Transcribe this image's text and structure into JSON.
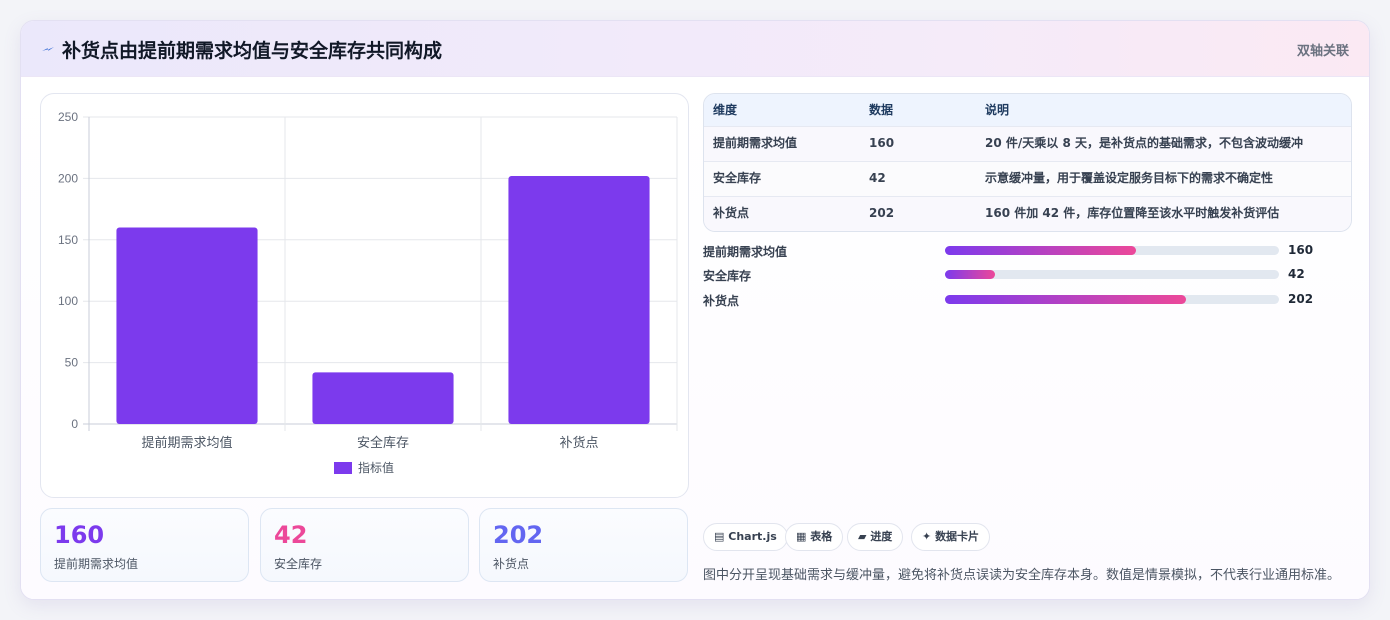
{
  "header": {
    "title": "补货点由提前期需求均值与安全库存共同构成",
    "tag": "双轴关联",
    "icon": "bolt-icon"
  },
  "chart_data": {
    "type": "bar",
    "categories": [
      "提前期需求均值",
      "安全库存",
      "补货点"
    ],
    "series": [
      {
        "name": "指标值",
        "values": [
          160,
          42,
          202
        ],
        "color": "#7c3aed"
      }
    ],
    "ylim": [
      0,
      250
    ],
    "yticks": [
      0,
      50,
      100,
      150,
      200,
      250
    ],
    "grid": true,
    "legend": "bottom"
  },
  "stats": [
    {
      "value": "160",
      "label": "提前期需求均值",
      "color": "#7c3aed"
    },
    {
      "value": "42",
      "label": "安全库存",
      "color": "#ec4899"
    },
    {
      "value": "202",
      "label": "补货点",
      "color": "#6366f1"
    }
  ],
  "table": {
    "headers": [
      "维度",
      "数据",
      "说明"
    ],
    "rows": [
      [
        "提前期需求均值",
        "160",
        "20 件/天乘以 8 天，是补货点的基础需求，不包含波动缓冲"
      ],
      [
        "安全库存",
        "42",
        "示意缓冲量，用于覆盖设定服务目标下的需求不确定性"
      ],
      [
        "补货点",
        "202",
        "160 件加 42 件，库存位置降至该水平时触发补货评估"
      ]
    ]
  },
  "progress": {
    "max": 280,
    "items": [
      {
        "label": "提前期需求均值",
        "value": 160
      },
      {
        "label": "安全库存",
        "value": 42
      },
      {
        "label": "补货点",
        "value": 202
      }
    ]
  },
  "chips": [
    {
      "icon": "chart-icon",
      "glyph": "▤",
      "label": "Chart.js"
    },
    {
      "icon": "table-icon",
      "glyph": "▦",
      "label": "表格"
    },
    {
      "icon": "progress-icon",
      "glyph": "▰",
      "label": "进度"
    },
    {
      "icon": "sparkle-icon",
      "glyph": "✦",
      "label": "数据卡片"
    }
  ],
  "note": "图中分开呈现基础需求与缓冲量，避免将补货点误读为安全库存本身。数值是情景模拟，不代表行业通用标准。"
}
